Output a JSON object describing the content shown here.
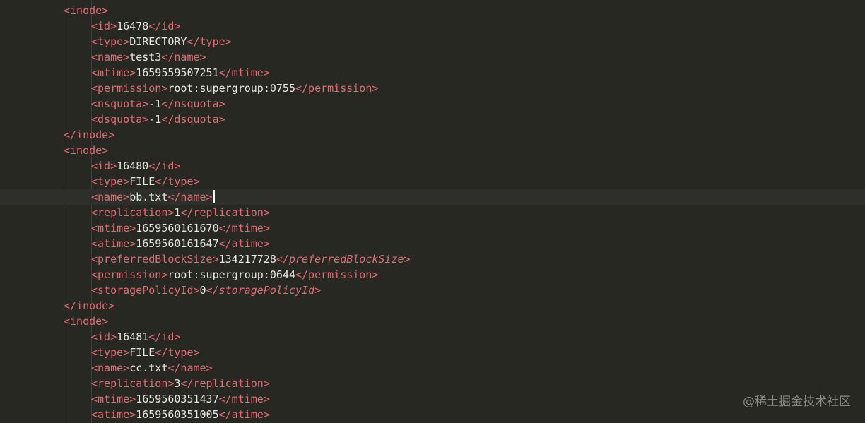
{
  "editor": {
    "theme_colors": {
      "background": "#272822",
      "tag": "#e06c75",
      "text": "#e8e8e2",
      "current_line": "#2e2f2a",
      "caret": "#f8f8f0"
    },
    "cursor_line": 12,
    "lines": [
      {
        "indent": 1,
        "open": "<inode>",
        "text": "",
        "close": ""
      },
      {
        "indent": 2,
        "open": "<id>",
        "text": "16478",
        "close": "</id>"
      },
      {
        "indent": 2,
        "open": "<type>",
        "text": "DIRECTORY",
        "close": "</type>"
      },
      {
        "indent": 2,
        "open": "<name>",
        "text": "test3",
        "close": "</name>"
      },
      {
        "indent": 2,
        "open": "<mtime>",
        "text": "1659559507251",
        "close": "</mtime>"
      },
      {
        "indent": 2,
        "open": "<permission>",
        "text": "root:supergroup:0755",
        "close": "</permission>"
      },
      {
        "indent": 2,
        "open": "<nsquota>",
        "text": "-1",
        "close": "</nsquota>"
      },
      {
        "indent": 2,
        "open": "<dsquota>",
        "text": "-1",
        "close": "</dsquota>"
      },
      {
        "indent": 1,
        "open": "</inode>",
        "text": "",
        "close": ""
      },
      {
        "indent": 1,
        "open": "<inode>",
        "text": "",
        "close": ""
      },
      {
        "indent": 2,
        "open": "<id>",
        "text": "16480",
        "close": "</id>"
      },
      {
        "indent": 2,
        "open": "<type>",
        "text": "FILE",
        "close": "</type>"
      },
      {
        "indent": 2,
        "open": "<name>",
        "text": "bb.txt",
        "close": "</name>"
      },
      {
        "indent": 2,
        "open": "<replication>",
        "text": "1",
        "close": "</replication>"
      },
      {
        "indent": 2,
        "open": "<mtime>",
        "text": "1659560161670",
        "close": "</mtime>"
      },
      {
        "indent": 2,
        "open": "<atime>",
        "text": "1659560161647",
        "close": "</atime>"
      },
      {
        "indent": 2,
        "open": "<preferredBlockSize>",
        "text": "134217728",
        "close": "</preferredBlockSize>"
      },
      {
        "indent": 2,
        "open": "<permission>",
        "text": "root:supergroup:0644",
        "close": "</permission>"
      },
      {
        "indent": 2,
        "open": "<storagePolicyId>",
        "text": "0",
        "close": "</storagePolicyId>"
      },
      {
        "indent": 1,
        "open": "</inode>",
        "text": "",
        "close": ""
      },
      {
        "indent": 1,
        "open": "<inode>",
        "text": "",
        "close": ""
      },
      {
        "indent": 2,
        "open": "<id>",
        "text": "16481",
        "close": "</id>"
      },
      {
        "indent": 2,
        "open": "<type>",
        "text": "FILE",
        "close": "</type>"
      },
      {
        "indent": 2,
        "open": "<name>",
        "text": "cc.txt",
        "close": "</name>"
      },
      {
        "indent": 2,
        "open": "<replication>",
        "text": "3",
        "close": "</replication>"
      },
      {
        "indent": 2,
        "open": "<mtime>",
        "text": "1659560351437",
        "close": "</mtime>"
      },
      {
        "indent": 2,
        "open": "<atime>",
        "text": "1659560351005",
        "close": "</atime>"
      }
    ]
  },
  "watermark": {
    "text": "@稀土掘金技术社区"
  }
}
